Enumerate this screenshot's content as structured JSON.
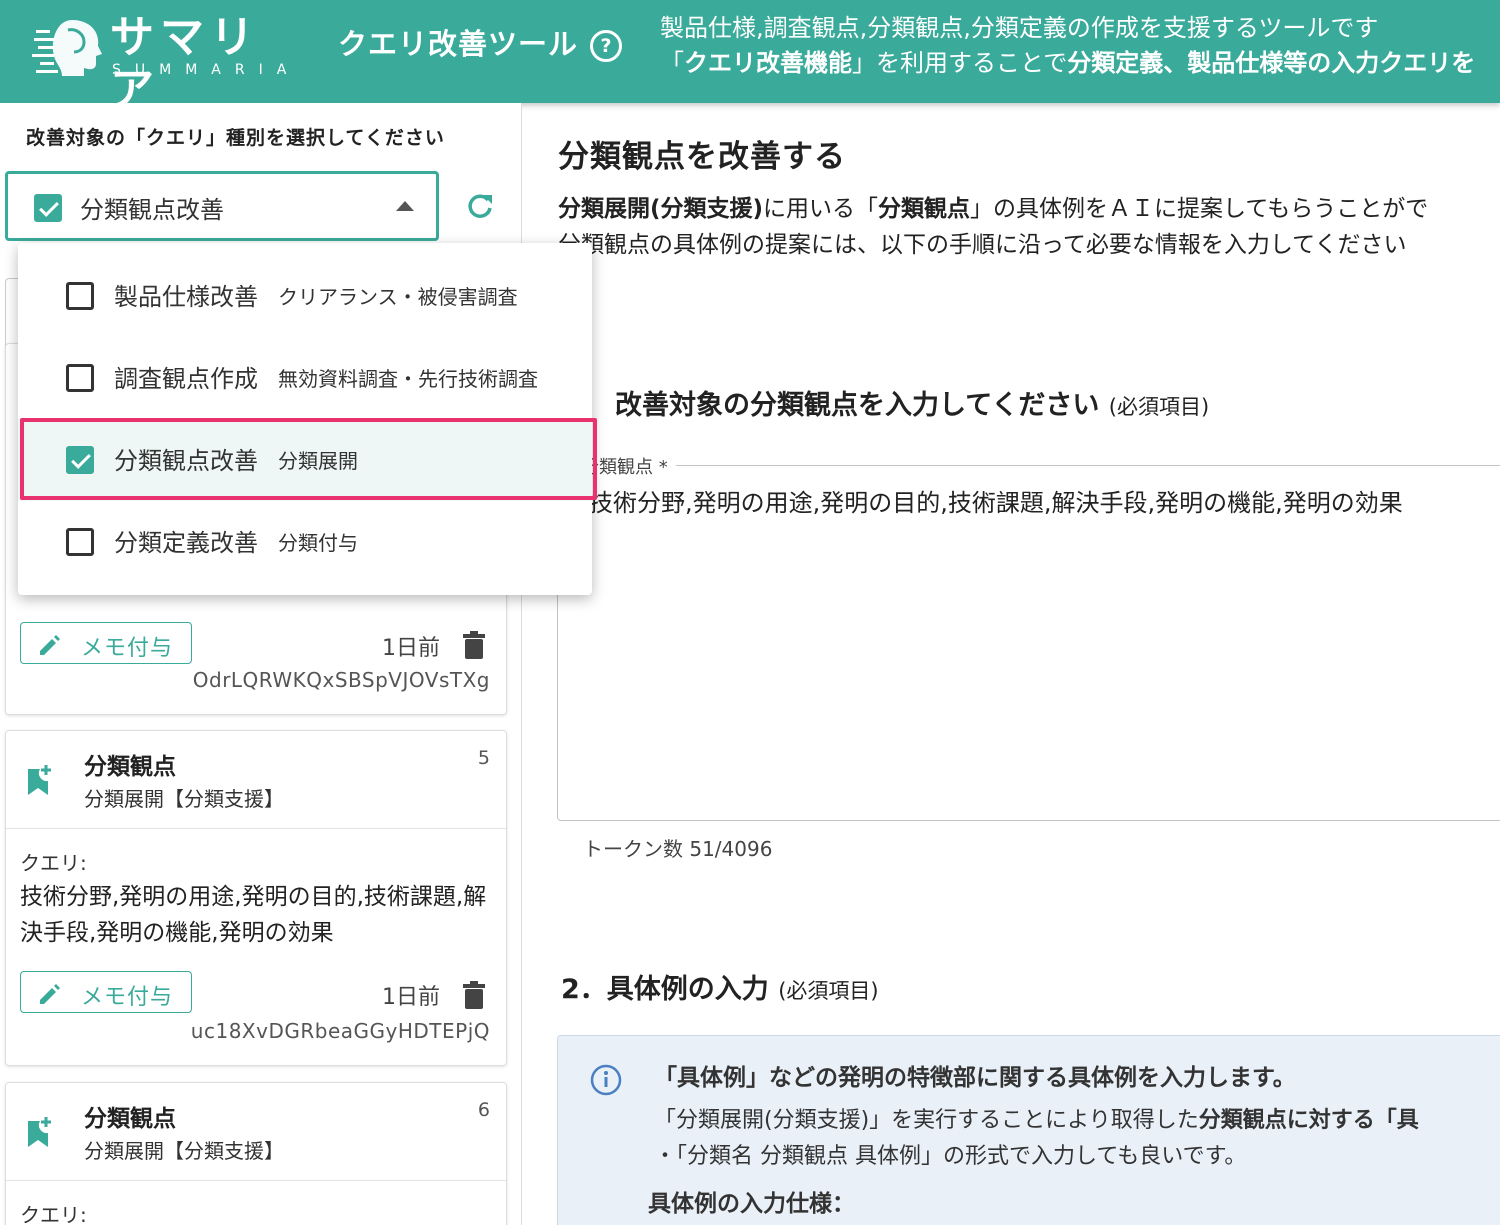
{
  "header": {
    "logo_text": "サマリア",
    "logo_sub": "SUMMARIA",
    "tool_title": "クエリ改善ツール",
    "help_glyph": "?",
    "desc_line1": "製品仕様,調査観点,分類観点,分類定義の作成を支援するツールです",
    "desc_line2_a": "「",
    "desc_line2_b": "クエリ改善機能",
    "desc_line2_c": "」を利用することで",
    "desc_line2_d": "分類定義、製品仕様等の入力クエリを"
  },
  "left": {
    "heading": "改善対象の「クエリ」種別を選択してください",
    "select_value": "分類観点改善",
    "refresh_icon": "refresh-icon"
  },
  "dropdown": {
    "items": [
      {
        "label": "製品仕様改善",
        "desc": "クリアランス・被侵害調査",
        "checked": false
      },
      {
        "label": "調査観点作成",
        "desc": "無効資料調査・先行技術調査",
        "checked": false
      },
      {
        "label": "分類観点改善",
        "desc": "分類展開",
        "checked": true
      },
      {
        "label": "分類定義改善",
        "desc": "分類付与",
        "checked": false
      }
    ]
  },
  "cards": [
    {
      "memo_label": "メモ付与",
      "time": "1日前",
      "id": "OdrLQRWKQxSBSpVJOVsTXg"
    },
    {
      "title": "分類観点",
      "subtitle": "分類展開【分類支援】",
      "number": "5",
      "query_label": "クエリ:",
      "query_text": "技術分野,発明の用途,発明の目的,技術課題,解決手段,発明の機能,発明の効果",
      "memo_label": "メモ付与",
      "time": "1日前",
      "id": "uc18XvDGRbeaGGyHDTEPjQ"
    },
    {
      "title": "分類観点",
      "subtitle": "分類展開【分類支援】",
      "number": "6",
      "query_label": "クエリ:"
    }
  ],
  "main": {
    "title": "分類観点を改善する",
    "intro1_a": "分類展開(分類支援)",
    "intro1_b": "に用いる「",
    "intro1_c": "分類観点",
    "intro1_d": "」の具体例をＡＩに提案してもらうことがで",
    "intro2": "分類観点の具体例の提案には、以下の手順に沿って必要な情報を入力してください",
    "section1_title": "改善対象の分類観点を入力してください",
    "required_tag": "(必須項目)",
    "field_label": "分類観点 *",
    "field_value": "技術分野,発明の用途,発明の目的,技術課題,解決手段,発明の機能,発明の効果",
    "token_count": "トークン数 51/4096",
    "section2_title": "2．具体例の入力",
    "info_title": "「具体例」などの発明の特徴部に関する具体例を入力します。",
    "info_line1_a": "「分類展開(分類支援)」を実行することにより取得した",
    "info_line1_b": "分類観点に対する「具",
    "info_line2": "・「分類名 分類観点 具体例」の形式で入力しても良いです。",
    "info_spec": "具体例の入力仕様："
  },
  "colors": {
    "brand": "#3aaa9a",
    "highlight": "#e8336f",
    "info_bg": "#e9f0f8"
  }
}
